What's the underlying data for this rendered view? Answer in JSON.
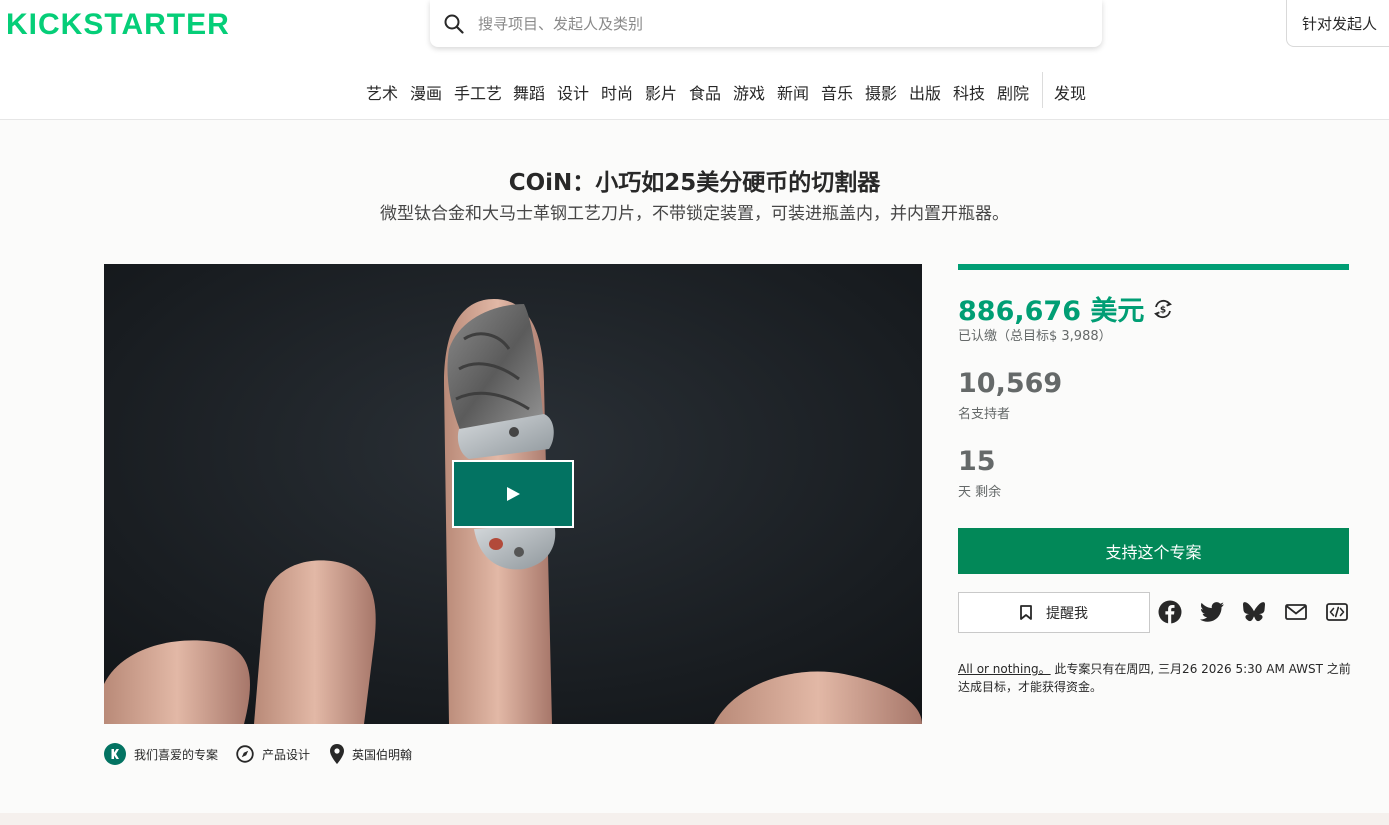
{
  "brand": {
    "logo_text": "KICKSTARTER",
    "color": "#05ce78"
  },
  "search": {
    "placeholder": "搜寻项目、发起人及类别",
    "value": ""
  },
  "header": {
    "creator_button": "针对发起人"
  },
  "categories": [
    "艺术",
    "漫画",
    "手工艺",
    "舞蹈",
    "设计",
    "时尚",
    "影片",
    "食品",
    "游戏",
    "新闻",
    "音乐",
    "摄影",
    "出版",
    "科技",
    "剧院"
  ],
  "discover": "发现",
  "project": {
    "title": "COiN：小巧如25美分硬币的切割器",
    "subtitle": "微型钛合金和大马士革钢工艺刀片，不带锁定装置，可装进瓶盖内，并内置开瓶器。"
  },
  "tags": [
    {
      "label": "我们喜爱的专案",
      "icon": "kickstarter-k-icon"
    },
    {
      "label": "产品设计",
      "icon": "compass-icon"
    },
    {
      "label": "英国伯明翰",
      "icon": "location-pin-icon"
    }
  ],
  "stats": {
    "progress_percent": 100,
    "pledged": "886,676 美元",
    "pledged_label": "已认缴（总目标$ 3,988）",
    "backers": "10,569",
    "backers_label": "名支持者",
    "days": "15",
    "days_label": "天 剩余"
  },
  "actions": {
    "back_label": "支持这个专案",
    "remind_label": "提醒我"
  },
  "share_icons": [
    "facebook-icon",
    "twitter-icon",
    "bluesky-icon",
    "email-icon",
    "embed-icon"
  ],
  "funding_note": {
    "link": "All or nothing。",
    "text": " 此专案只有在周四, 三月26 2026 5:30 AM AWST 之前达成目标，才能获得资金。"
  },
  "colors": {
    "accent_green": "#009e74",
    "button_green": "#028858",
    "play_green": "#037362"
  }
}
